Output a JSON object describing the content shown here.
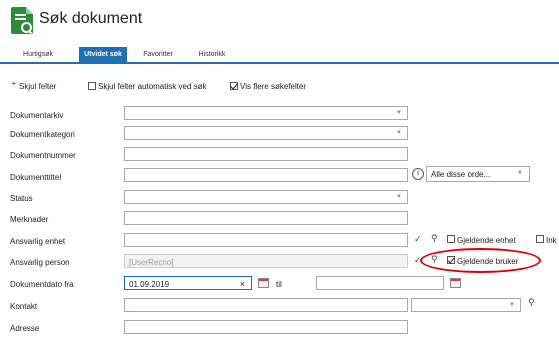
{
  "header": {
    "title": "Søk dokument"
  },
  "tabs": [
    {
      "label": "Hurtigsøk"
    },
    {
      "label": "Utvidet søk"
    },
    {
      "label": "Favoritter"
    },
    {
      "label": "Historikk"
    }
  ],
  "toolbar": {
    "hide_fields": "Skjul felter",
    "auto_hide": "Skjul felter automatisk ved søk",
    "show_more": "Vis flere søkefelter"
  },
  "fields": {
    "archive": {
      "label": "Dokumentarkiv"
    },
    "category": {
      "label": "Dokumentkategori"
    },
    "number": {
      "label": "Dokumentnummer"
    },
    "title": {
      "label": "Dokumenttittel",
      "option": "Alle disse orde..."
    },
    "status": {
      "label": "Status"
    },
    "remarks": {
      "label": "Merknader"
    },
    "unit": {
      "label": "Ansvarlig enhet",
      "current_unit": "Gjeldende enhet",
      "include": "Ink"
    },
    "person": {
      "label": "Ansvarlig person",
      "placeholder": "[UserRecno]",
      "current_user": "Gjeldende bruker"
    },
    "date": {
      "label": "Dokumentdato fra",
      "from": "01.09.2019",
      "to_label": "til"
    },
    "contact": {
      "label": "Kontakt"
    },
    "address": {
      "label": "Adresse"
    }
  },
  "colors": {
    "accent": "#1f6fb5",
    "icon_green": "#2e8b3a",
    "callout": "#e00000"
  }
}
